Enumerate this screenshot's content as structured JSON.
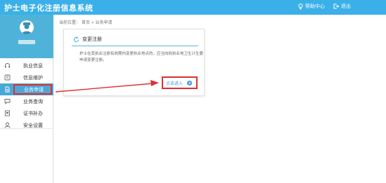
{
  "app": {
    "title": "护士电子化注册信息系统"
  },
  "header": {
    "help_label": "帮助中心",
    "exit_label": "退出"
  },
  "sidebar": {
    "items": [
      {
        "label": "执业信息",
        "icon": "headset-icon"
      },
      {
        "label": "信息维护",
        "icon": "info-maintain-icon"
      },
      {
        "label": "业务申请",
        "icon": "document-icon",
        "active": true
      },
      {
        "label": "业务查询",
        "icon": "chat-icon"
      },
      {
        "label": "证书补办",
        "icon": "certificate-icon"
      },
      {
        "label": "安全设置",
        "icon": "user-icon"
      }
    ]
  },
  "breadcrumb": {
    "prefix": "当前位置：",
    "home": "首页",
    "sep": "»",
    "current": "业务申请"
  },
  "card": {
    "title": "变更注册",
    "description": "护士在其执业注册有效期内变更执业地点的，应当向拟执业地卫生计生委申请变更注册。",
    "action_label": "点击进入"
  },
  "colors": {
    "topbar": "#3bb0e8",
    "active": "#4aa8d8",
    "highlight": "#e03030",
    "link": "#3b9bd4"
  }
}
